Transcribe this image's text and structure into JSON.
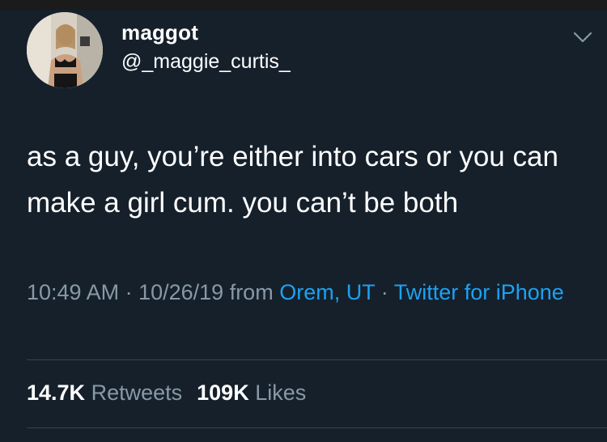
{
  "author": {
    "display_name": "maggot",
    "handle": "@_maggie_curtis_"
  },
  "menu_icon": "chevron-down-icon",
  "tweet": {
    "text": "as a guy, you’re either into cars or you can make a girl cum. you can’t be both"
  },
  "meta": {
    "time": "10:49 AM",
    "separator": " · ",
    "date": "10/26/19",
    "from_label": " from ",
    "location": "Orem, UT",
    "source": "Twitter for iPhone"
  },
  "stats": {
    "retweets_count": "14.7K",
    "retweets_label": "Retweets",
    "likes_count": "109K",
    "likes_label": "Likes"
  },
  "colors": {
    "background": "#15202b",
    "text": "#ffffff",
    "secondary_text": "#8899a6",
    "link": "#1da1f2",
    "divider": "#38444d"
  }
}
